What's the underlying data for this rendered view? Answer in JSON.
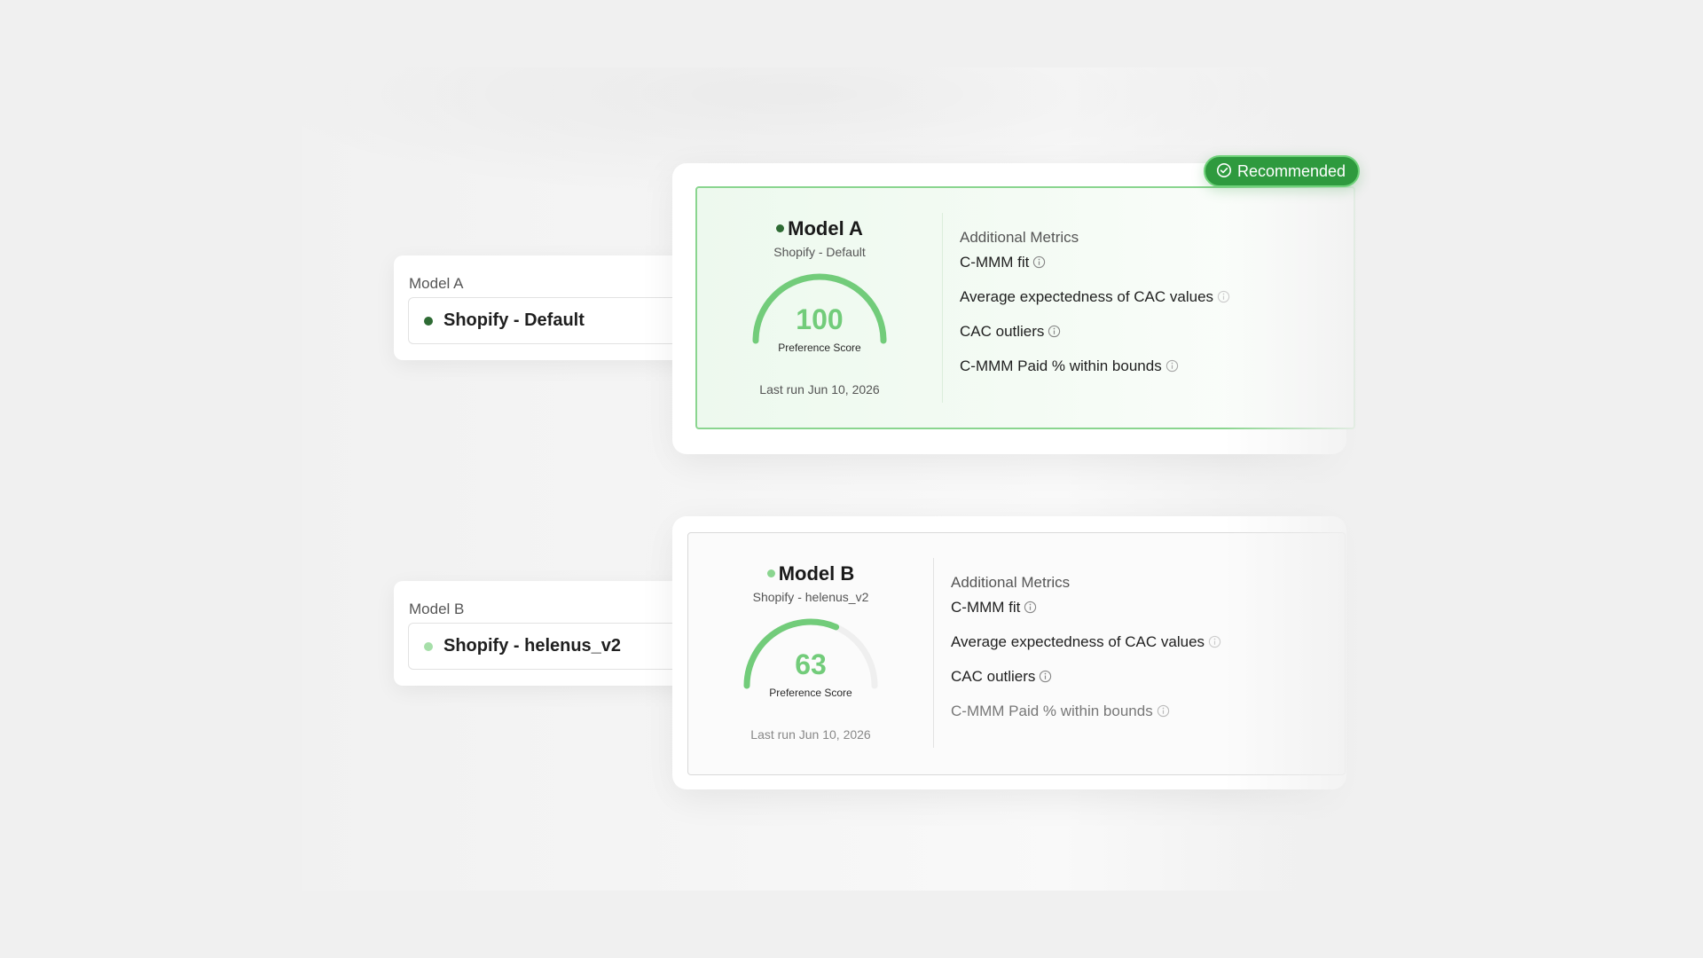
{
  "selectors": [
    {
      "label": "Model A",
      "value": "Shopify - Default",
      "dot_color": "#2e6b34"
    },
    {
      "label": "Model B",
      "value": "Shopify - helenus_v2",
      "dot_color": "#a6dfa9"
    }
  ],
  "badge": {
    "label": "Recommended",
    "icon": "check-circle-icon",
    "color": "#2e9a3e"
  },
  "cards": [
    {
      "title": "Model A",
      "subtitle": "Shopify - Default",
      "dot_color": "#2e6b34",
      "score": "100",
      "score_fraction": 1.0,
      "score_label": "Preference Score",
      "last_run": "Last run Jun 10, 2026",
      "metrics_heading": "Additional Metrics",
      "metrics": [
        "C-MMM fit",
        "Average expectedness of CAC values",
        "CAC outliers",
        "C-MMM Paid % within bounds"
      ]
    },
    {
      "title": "Model B",
      "subtitle": "Shopify - helenus_v2",
      "dot_color": "#8ad58f",
      "score": "63",
      "score_fraction": 0.63,
      "score_label": "Preference Score",
      "last_run": "Last run Jun 10, 2026",
      "metrics_heading": "Additional Metrics",
      "metrics": [
        "C-MMM fit",
        "Average expectedness of CAC values",
        "CAC outliers",
        "C-MMM Paid % within bounds"
      ]
    }
  ],
  "colors": {
    "gauge": "#72cc7a",
    "gauge_track": "#efefef"
  }
}
